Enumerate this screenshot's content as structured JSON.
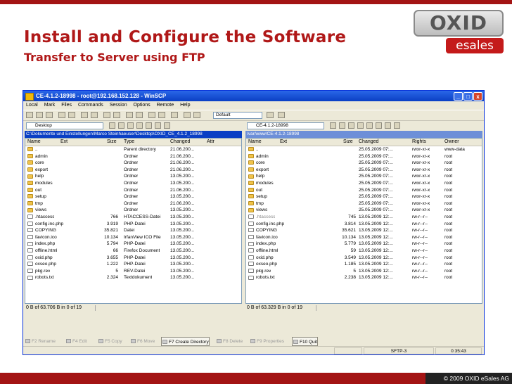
{
  "slide": {
    "title": "Install and Configure the Software",
    "subtitle": "Transfer to Server using FTP",
    "logo_main": "OXID",
    "logo_sub": "esales",
    "copyright": "© 2009 OXID eSales AG"
  },
  "window": {
    "title": "CE-4.1.2-18998 - root@192.168.152.128 - WinSCP",
    "controls": [
      "_",
      "□",
      "x"
    ],
    "menu": [
      "Local",
      "Mark",
      "Files",
      "Commands",
      "Session",
      "Options",
      "Remote",
      "Help"
    ],
    "transfer_setting": "Default"
  },
  "left_panel": {
    "location": "Desktop",
    "path": "C:\\Dokumente und Einstellungen\\Marco Steinhaeuser\\Desktop\\OXID_CE_4.1.2_18998",
    "columns": [
      "Name",
      "Ext",
      "Size",
      "Type",
      "Changed",
      "Attr"
    ],
    "rows": [
      {
        "name": "..",
        "size": "",
        "type": "Parent directory",
        "changed": "21.06.200...",
        "attr": "",
        "icon": "up"
      },
      {
        "name": "admin",
        "size": "",
        "type": "Ordner",
        "changed": "21.06.200...",
        "attr": "",
        "icon": "folder"
      },
      {
        "name": "core",
        "size": "",
        "type": "Ordner",
        "changed": "21.06.200...",
        "attr": "",
        "icon": "folder"
      },
      {
        "name": "export",
        "size": "",
        "type": "Ordner",
        "changed": "21.06.200...",
        "attr": "",
        "icon": "folder"
      },
      {
        "name": "help",
        "size": "",
        "type": "Ordner",
        "changed": "13.05.200...",
        "attr": "",
        "icon": "folder"
      },
      {
        "name": "modules",
        "size": "",
        "type": "Ordner",
        "changed": "13.05.200...",
        "attr": "",
        "icon": "folder"
      },
      {
        "name": "out",
        "size": "",
        "type": "Ordner",
        "changed": "21.06.200...",
        "attr": "",
        "icon": "folder"
      },
      {
        "name": "setup",
        "size": "",
        "type": "Ordner",
        "changed": "13.05.200...",
        "attr": "",
        "icon": "folder"
      },
      {
        "name": "tmp",
        "size": "",
        "type": "Ordner",
        "changed": "21.06.200...",
        "attr": "",
        "icon": "folder"
      },
      {
        "name": "views",
        "size": "",
        "type": "Ordner",
        "changed": "13.05.200...",
        "attr": "",
        "icon": "folder"
      },
      {
        "name": ".htaccess",
        "size": "766",
        "type": "HTACCESS-Datei",
        "changed": "13.05.200...",
        "attr": "",
        "icon": "file"
      },
      {
        "name": "config.inc.php",
        "size": "3.919",
        "type": "PHP-Datei",
        "changed": "13.05.200...",
        "attr": "",
        "icon": "file"
      },
      {
        "name": "COPYING",
        "size": "35.821",
        "type": "Datei",
        "changed": "13.05.200...",
        "attr": "",
        "icon": "file"
      },
      {
        "name": "favicon.ico",
        "size": "10.134",
        "type": "IrfanView ICO File",
        "changed": "13.05.200...",
        "attr": "",
        "icon": "file"
      },
      {
        "name": "index.php",
        "size": "5.794",
        "type": "PHP-Datei",
        "changed": "13.05.200...",
        "attr": "",
        "icon": "file"
      },
      {
        "name": "offline.html",
        "size": "66",
        "type": "Firefox Document",
        "changed": "13.05.200...",
        "attr": "",
        "icon": "file"
      },
      {
        "name": "oxid.php",
        "size": "3.655",
        "type": "PHP-Datei",
        "changed": "13.05.200...",
        "attr": "",
        "icon": "file"
      },
      {
        "name": "oxseo.php",
        "size": "1.222",
        "type": "PHP-Datei",
        "changed": "13.05.200...",
        "attr": "",
        "icon": "file"
      },
      {
        "name": "pkg.rev",
        "size": "5",
        "type": "REV-Datei",
        "changed": "13.05.200...",
        "attr": "",
        "icon": "file"
      },
      {
        "name": "robots.txt",
        "size": "2.324",
        "type": "Textdokument",
        "changed": "13.05.200...",
        "attr": "",
        "icon": "file"
      }
    ],
    "status": "0 B of 63.706 B in 0 of 19"
  },
  "right_panel": {
    "location": "CE-4.1.2-18998",
    "path": "/var/www/CE-4.1.2-18998",
    "columns": [
      "Name",
      "Ext",
      "Size",
      "Changed",
      "Rights",
      "Owner"
    ],
    "rows": [
      {
        "name": "..",
        "size": "",
        "changed": "25.05.2009 07:...",
        "rights": "rwxr-xr-x",
        "owner": "www-data",
        "icon": "up"
      },
      {
        "name": "admin",
        "size": "",
        "changed": "25.05.2009 07:...",
        "rights": "rwxr-xr-x",
        "owner": "root",
        "icon": "folder"
      },
      {
        "name": "core",
        "size": "",
        "changed": "25.05.2009 07:...",
        "rights": "rwxr-xr-x",
        "owner": "root",
        "icon": "folder"
      },
      {
        "name": "export",
        "size": "",
        "changed": "25.05.2009 07:...",
        "rights": "rwxr-xr-x",
        "owner": "root",
        "icon": "folder"
      },
      {
        "name": "help",
        "size": "",
        "changed": "25.05.2009 07:...",
        "rights": "rwxr-xr-x",
        "owner": "root",
        "icon": "folder"
      },
      {
        "name": "modules",
        "size": "",
        "changed": "25.05.2009 07:...",
        "rights": "rwxr-xr-x",
        "owner": "root",
        "icon": "folder"
      },
      {
        "name": "out",
        "size": "",
        "changed": "25.05.2009 07:...",
        "rights": "rwxr-xr-x",
        "owner": "root",
        "icon": "folder"
      },
      {
        "name": "setup",
        "size": "",
        "changed": "25.05.2009 07:...",
        "rights": "rwxr-xr-x",
        "owner": "root",
        "icon": "folder"
      },
      {
        "name": "tmp",
        "size": "",
        "changed": "25.05.2009 07:...",
        "rights": "rwxr-xr-x",
        "owner": "root",
        "icon": "folder"
      },
      {
        "name": "views",
        "size": "",
        "changed": "25.05.2009 07:...",
        "rights": "rwxr-xr-x",
        "owner": "root",
        "icon": "folder"
      },
      {
        "name": ".htaccess",
        "size": "745",
        "changed": "13.05.2009 12:...",
        "rights": "rw-r--r--",
        "owner": "root",
        "icon": "file",
        "hidden": true
      },
      {
        "name": "config.inc.php",
        "size": "3.814",
        "changed": "13.05.2009 12:...",
        "rights": "rw-r--r--",
        "owner": "root",
        "icon": "file"
      },
      {
        "name": "COPYING",
        "size": "35.621",
        "changed": "13.05.2009 12:...",
        "rights": "rw-r--r--",
        "owner": "root",
        "icon": "file"
      },
      {
        "name": "favicon.ico",
        "size": "10.134",
        "changed": "13.05.2009 12:...",
        "rights": "rw-r--r--",
        "owner": "root",
        "icon": "file"
      },
      {
        "name": "index.php",
        "size": "5.779",
        "changed": "13.05.2009 12:...",
        "rights": "rw-r--r--",
        "owner": "root",
        "icon": "file"
      },
      {
        "name": "offline.html",
        "size": "59",
        "changed": "13.05.2009 12:...",
        "rights": "rw-r--r--",
        "owner": "root",
        "icon": "file"
      },
      {
        "name": "oxid.php",
        "size": "3.549",
        "changed": "13.05.2009 12:...",
        "rights": "rw-r--r--",
        "owner": "root",
        "icon": "file"
      },
      {
        "name": "oxseo.php",
        "size": "1.185",
        "changed": "13.05.2009 12:...",
        "rights": "rw-r--r--",
        "owner": "root",
        "icon": "file"
      },
      {
        "name": "pkg.rev",
        "size": "5",
        "changed": "13.05.2009 12:...",
        "rights": "rw-r--r--",
        "owner": "root",
        "icon": "file"
      },
      {
        "name": "robots.txt",
        "size": "2.238",
        "changed": "13.05.2009 12:...",
        "rights": "rw-r--r--",
        "owner": "root",
        "icon": "file"
      }
    ],
    "status": "0 B of 63.329 B in 0 of 19"
  },
  "fkeys": [
    {
      "label": "F2 Rename",
      "enabled": false
    },
    {
      "label": "F4 Edit",
      "enabled": false
    },
    {
      "label": "F5 Copy",
      "enabled": false
    },
    {
      "label": "F6 Move",
      "enabled": false
    },
    {
      "label": "F7 Create Directory",
      "enabled": true
    },
    {
      "label": "F8 Delete",
      "enabled": false
    },
    {
      "label": "F9 Properties",
      "enabled": false
    },
    {
      "label": "F10 Quit",
      "enabled": true
    }
  ],
  "statusbar": {
    "protocol": "SFTP-3",
    "elapsed": "0:35:43"
  }
}
